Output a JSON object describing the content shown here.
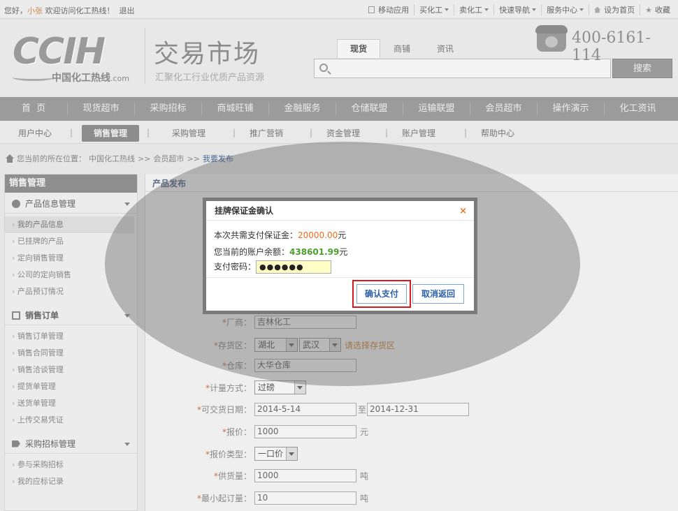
{
  "topbar": {
    "greeting_pre": "您好，",
    "username": "小张",
    "greeting_post": " 欢迎访问化工热线！",
    "logout": "退出",
    "links": [
      {
        "label": "移动应用",
        "caret": false,
        "icon": "mobile-icon"
      },
      {
        "label": "买化工",
        "caret": true
      },
      {
        "label": "卖化工",
        "caret": true
      },
      {
        "label": "快速导航",
        "caret": true
      },
      {
        "label": "服务中心",
        "caret": true
      },
      {
        "label": "设为首页",
        "caret": false,
        "icon": "home-icon"
      },
      {
        "label": "收藏",
        "caret": false,
        "icon": "star-icon"
      }
    ]
  },
  "header": {
    "logo_text": "CCIH",
    "logo_sub": "中国化工热线",
    "logo_dot": ".com",
    "market_title": "交易市场",
    "market_subtitle": "汇聚化工行业优质产品资源",
    "search_tabs": [
      "现货",
      "商铺",
      "资讯"
    ],
    "search_active_tab": 0,
    "search_value": "",
    "search_button": "搜索",
    "phone": "400-6161-114"
  },
  "nav": [
    "首  页",
    "现货超市",
    "采购招标",
    "商城旺铺",
    "金融服务",
    "仓储联盟",
    "运输联盟",
    "会员超市",
    "操作演示",
    "化工资讯"
  ],
  "subnav": {
    "items": [
      "用户中心",
      "销售管理",
      "采购管理",
      "推广营销",
      "资金管理",
      "账户管理",
      "帮助中心"
    ],
    "active": 1
  },
  "breadcrumb": {
    "prefix": "您当前的所在位置：",
    "items": [
      "中国化工热线",
      "会员超市",
      "我要发布"
    ],
    "sep": ">>"
  },
  "sidebar": {
    "title": "销售管理",
    "sections": [
      {
        "title": "产品信息管理",
        "items": [
          "我的产品信息",
          "已挂牌的产品",
          "定向销售管理",
          "公司的定向销售",
          "产品预订情况"
        ],
        "active": 0
      },
      {
        "title": "销售订单",
        "items": [
          "销售订单管理",
          "销售合同管理",
          "销售洽谈管理",
          "提货单管理",
          "送货单管理",
          "上传交易凭证"
        ],
        "active": -1
      },
      {
        "title": "采购招标管理",
        "items": [
          "参与采购招标",
          "我的应标记录"
        ],
        "active": -1
      }
    ]
  },
  "main": {
    "title": "产品发布",
    "form": {
      "maker_label": "厂商：",
      "maker_value": "吉林化工",
      "storage_label": "存货区：",
      "storage_province": "湖北",
      "storage_city": "武汉",
      "storage_hint": "请选择存货区",
      "warehouse_label": "仓库：",
      "warehouse_value": "大华仓库",
      "measure_label": "计量方式：",
      "measure_value": "过磅",
      "date_label": "可交货日期：",
      "date_from": "2014-5-14",
      "date_to_sep": "至",
      "date_to": "2014-12-31",
      "price_label": "报价：",
      "price_value": "1000",
      "price_unit": "元",
      "price_type_label": "报价类型：",
      "price_type_value": "一口价",
      "supply_label": "供货量：",
      "supply_value": "1000",
      "supply_unit": "吨",
      "min_label": "最小起订量：",
      "min_value": "10",
      "min_unit": "吨"
    }
  },
  "dialog": {
    "title": "挂牌保证金确认",
    "close": "×",
    "deposit_label": "本次共需支付保证金：",
    "deposit_value": "20000.00",
    "deposit_unit": "元",
    "balance_label": "您当前的账户余额：",
    "balance_value": "438601.99",
    "balance_unit": "元",
    "password_label": "支付密码：",
    "password_mask": "●●●●●●",
    "confirm_button": "确认支付",
    "cancel_button": "取消返回"
  }
}
